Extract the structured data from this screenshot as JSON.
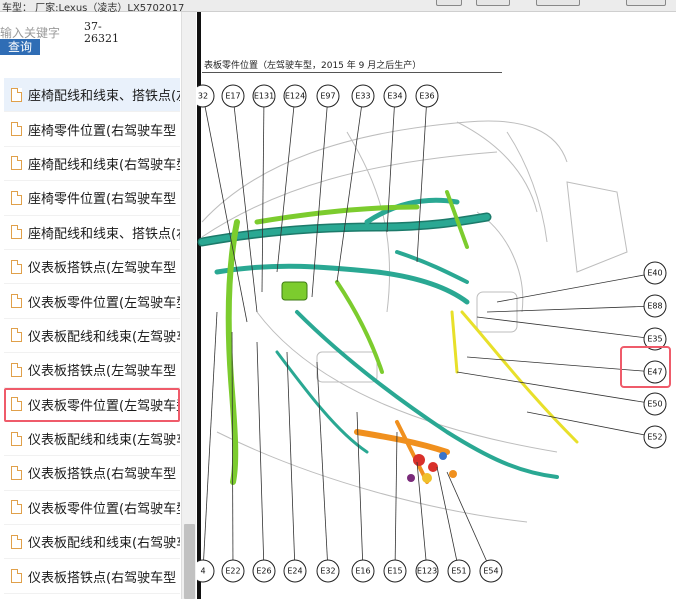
{
  "window": {
    "title": "车型：  厂家:Lexus（凌志）LX5702017"
  },
  "search": {
    "placeholder": "输入关键字",
    "button_label": "查询",
    "code": "37-26321"
  },
  "sidebar": {
    "items": [
      {
        "label": "座椅配线和线束、搭铁点(左",
        "state": "hover"
      },
      {
        "label": "座椅零件位置(右驾驶车型"
      },
      {
        "label": "座椅配线和线束(右驾驶车型"
      },
      {
        "label": "座椅零件位置(右驾驶车型"
      },
      {
        "label": "座椅配线和线束、搭铁点(右"
      },
      {
        "label": "仪表板搭铁点(左驾驶车型"
      },
      {
        "label": "仪表板零件位置(左驾驶车型"
      },
      {
        "label": "仪表板配线和线束(左驾驶车"
      },
      {
        "label": "仪表板搭铁点(左驾驶车型"
      },
      {
        "label": "仪表板零件位置(左驾驶车型",
        "state": "selected"
      },
      {
        "label": "仪表板配线和线束(左驾驶车"
      },
      {
        "label": "仪表板搭铁点(右驾驶车型"
      },
      {
        "label": "仪表板零件位置(右驾驶车型"
      },
      {
        "label": "仪表板配线和线束(右驾驶车"
      },
      {
        "label": "仪表板搭铁点(右驾驶车型"
      },
      {
        "label": "仪表板零件位置(右驾驶车"
      }
    ]
  },
  "diagram": {
    "title": "表板零件位置（左驾驶车型，2015 年 9 月之后生产）",
    "top_connectors": [
      "32",
      "E17",
      "E131",
      "E124",
      "E97",
      "E33",
      "E34",
      "E36"
    ],
    "right_connectors": [
      "E40",
      "E88",
      "E35",
      "E47",
      "E50",
      "E52"
    ],
    "bottom_connectors": [
      "4",
      "E22",
      "E26",
      "E24",
      "E32",
      "E16",
      "E15",
      "E123",
      "E51",
      "E54"
    ],
    "highlighted_connector": "E47",
    "colors": {
      "harness_teal": "#2aa893",
      "harness_green": "#7ccc2e",
      "harness_yellow": "#e8e02a",
      "harness_orange": "#f0901e",
      "highlight": "#ef5b6a"
    }
  }
}
